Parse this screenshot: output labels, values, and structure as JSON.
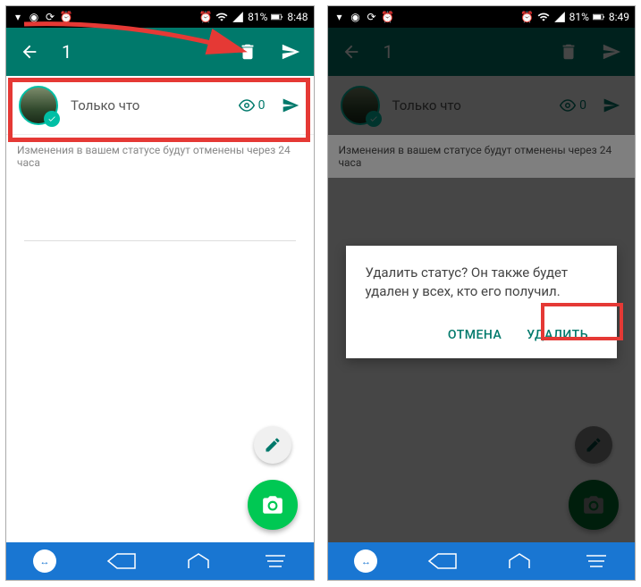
{
  "statusbar": {
    "battery_pct": "81%",
    "time_left": "8:48",
    "time_right": "8:49"
  },
  "appbar": {
    "title": "1"
  },
  "statusItem": {
    "label": "Только что",
    "views": "0"
  },
  "infoText": "Изменения в вашем статусе будут отменены через 24 часа",
  "dialog": {
    "message": "Удалить статус? Он также будет удален у всех, кто его получил.",
    "cancel": "ОТМЕНА",
    "confirm": "УДАЛИТЬ"
  }
}
